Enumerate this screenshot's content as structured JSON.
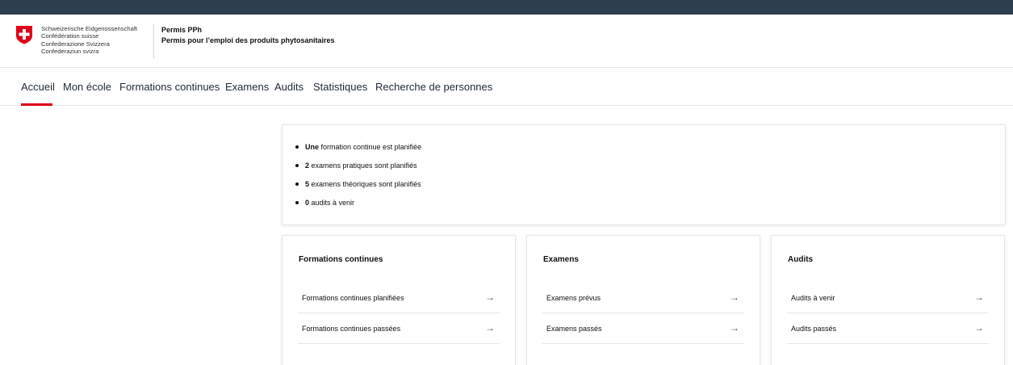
{
  "header": {
    "federation_names": [
      "Schweizerische Eidgenossenschaft",
      "Confédération suisse",
      "Confederazione Svizzera",
      "Confederaziun svizra"
    ],
    "app_name": "Permis PPh",
    "app_description": "Permis pour l’emploi des produits phytosanitaires",
    "flag_icon": "swiss-cross-icon",
    "colors": {
      "topbar": "#2d3e4e",
      "flag_red": "#dc0018"
    }
  },
  "nav": {
    "items": [
      "Accueil",
      "Mon école",
      "Formations continues",
      "Examens",
      "Audits",
      "Statistiques",
      "Recherche de personnes"
    ],
    "active": "Accueil",
    "active_color": "#dc0018"
  },
  "summary": {
    "items": [
      {
        "strong": "Une",
        "text": " formation continue est planifiée"
      },
      {
        "strong": "2",
        "text": " examens pratiques sont planifiés"
      },
      {
        "strong": "5",
        "text": " examens théoriques sont planifiés"
      },
      {
        "strong": "0",
        "text": " audits à venir"
      }
    ]
  },
  "cards": [
    {
      "title": "Formations continues",
      "links": [
        "Formations continues planifiées",
        "Formations continues passées"
      ]
    },
    {
      "title": "Examens",
      "links": [
        "Examens prévus",
        "Examens passés"
      ]
    },
    {
      "title": "Audits",
      "links": [
        "Audits à venir",
        "Audits passés"
      ]
    }
  ],
  "icons": {
    "link_arrow": "arrow-right-icon",
    "arrow_glyph": "→"
  }
}
